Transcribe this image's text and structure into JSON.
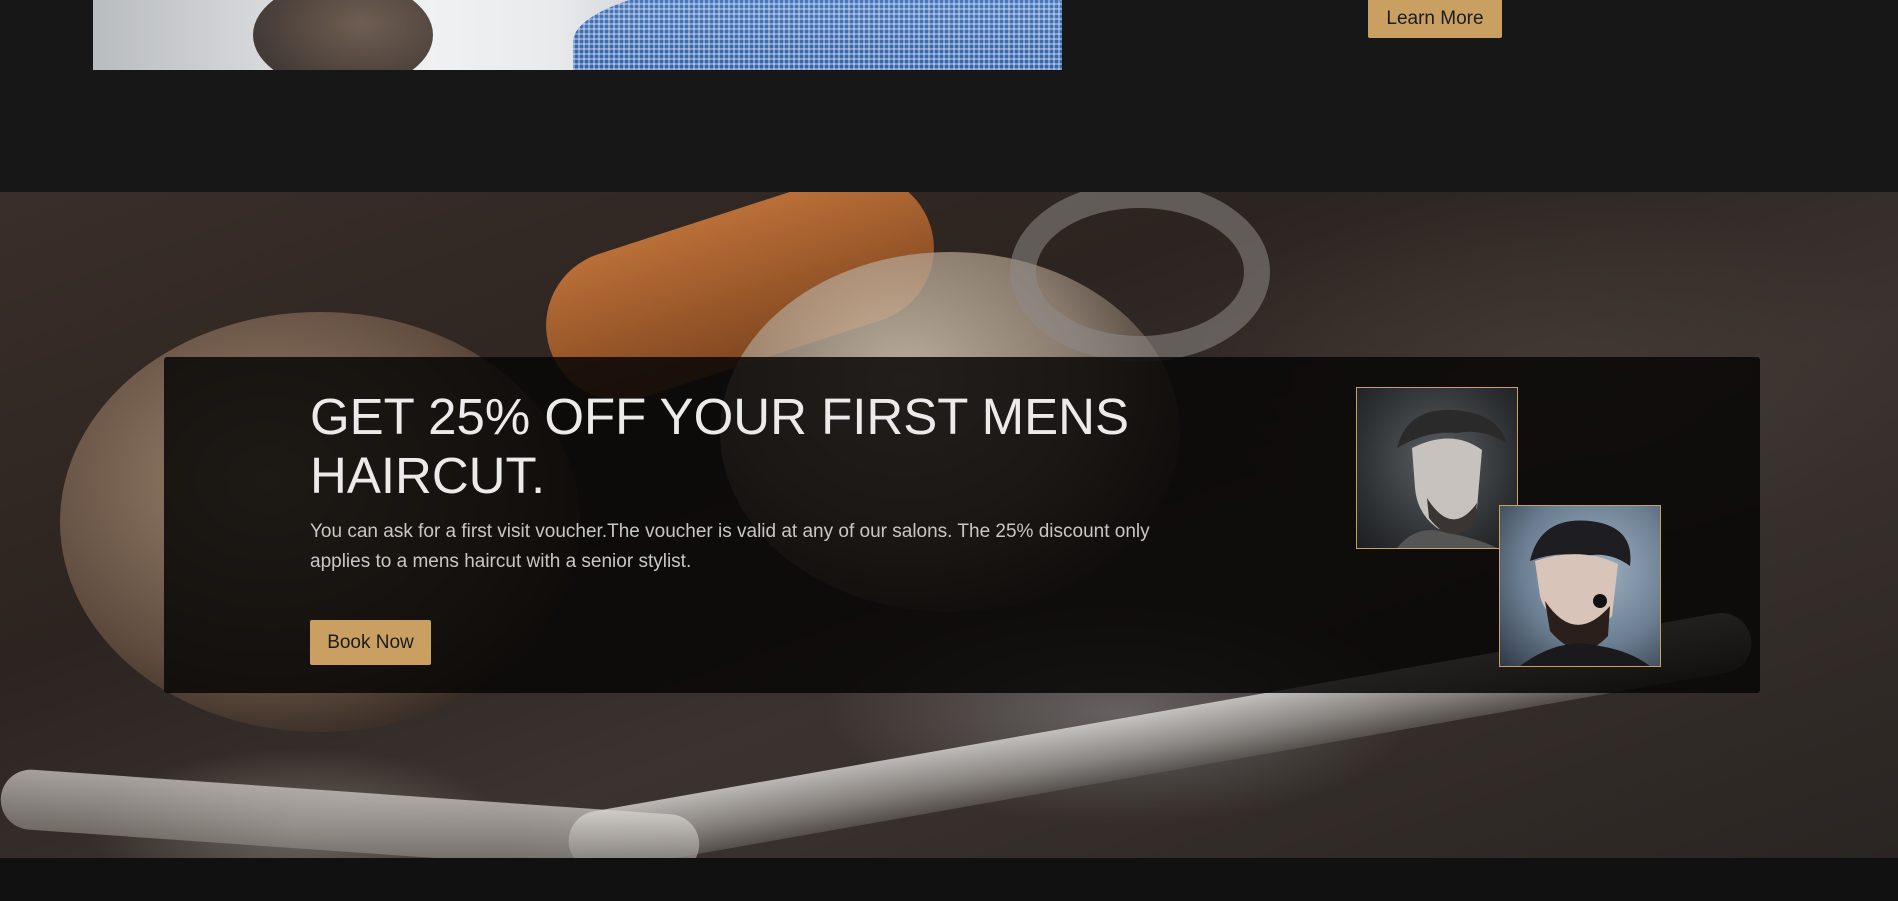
{
  "top_section": {
    "learn_more_label": "Learn More"
  },
  "promo": {
    "title": "GET 25% OFF YOUR FIRST MENS HAIRCUT.",
    "description": "You can ask for a first visit voucher.The voucher is valid at any of our salons. The 25% discount only applies to a mens haircut with a senior stylist.",
    "book_now_label": "Book Now"
  },
  "colors": {
    "page_background": "#171717",
    "accent": "#c9a062",
    "promo_box": "#080706",
    "footer_strip": "#111111"
  }
}
